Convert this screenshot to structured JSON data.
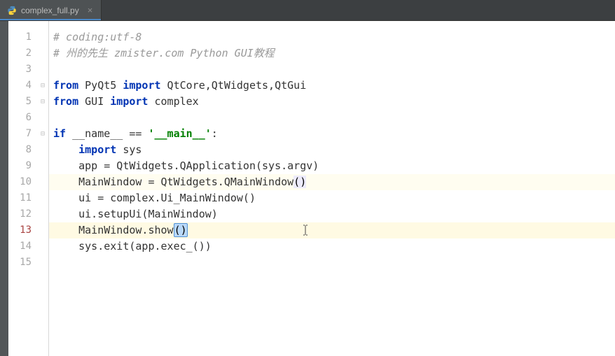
{
  "tab": {
    "filename": "complex_full.py",
    "icon": "python-file-icon"
  },
  "gutter": {
    "lines": [
      "1",
      "2",
      "3",
      "4",
      "5",
      "6",
      "7",
      "8",
      "9",
      "10",
      "11",
      "12",
      "13",
      "14",
      "15"
    ],
    "current_line_index": 12
  },
  "code": {
    "lines": [
      {
        "type": "comment",
        "text": "# coding:utf-8"
      },
      {
        "type": "comment",
        "text": "# 州的先生 zmister.com Python GUI教程"
      },
      {
        "type": "blank",
        "text": ""
      },
      {
        "type": "import1",
        "kw1": "from",
        "mod1": "PyQt5",
        "kw2": "import",
        "rest": " QtCore,QtWidgets,QtGui"
      },
      {
        "type": "import1",
        "kw1": "from",
        "mod1": "GUI",
        "kw2": "import",
        "rest": " complex"
      },
      {
        "type": "blank",
        "text": ""
      },
      {
        "type": "ifmain",
        "kw": "if",
        "name": " __name__ ",
        "eq": "==",
        "str": " '__main__'",
        "colon": ":"
      },
      {
        "type": "indent_import",
        "indent": "    ",
        "kw": "import",
        "rest": " sys"
      },
      {
        "type": "plain",
        "indent": "    ",
        "text": "app = QtWidgets.QApplication(sys.argv)"
      },
      {
        "type": "hl_line",
        "indent": "    ",
        "prefix": "MainWindow = QtWidgets.QMainWindow",
        "paren": "()"
      },
      {
        "type": "plain",
        "indent": "    ",
        "text": "ui = complex.Ui_MainWindow()"
      },
      {
        "type": "plain",
        "indent": "    ",
        "text": "ui.setupUi(MainWindow)"
      },
      {
        "type": "cursor_line",
        "indent": "    ",
        "prefix": "MainWindow.show",
        "paren": "()"
      },
      {
        "type": "plain",
        "indent": "    ",
        "text": "sys.exit(app.exec_())"
      },
      {
        "type": "blank",
        "text": ""
      }
    ]
  }
}
